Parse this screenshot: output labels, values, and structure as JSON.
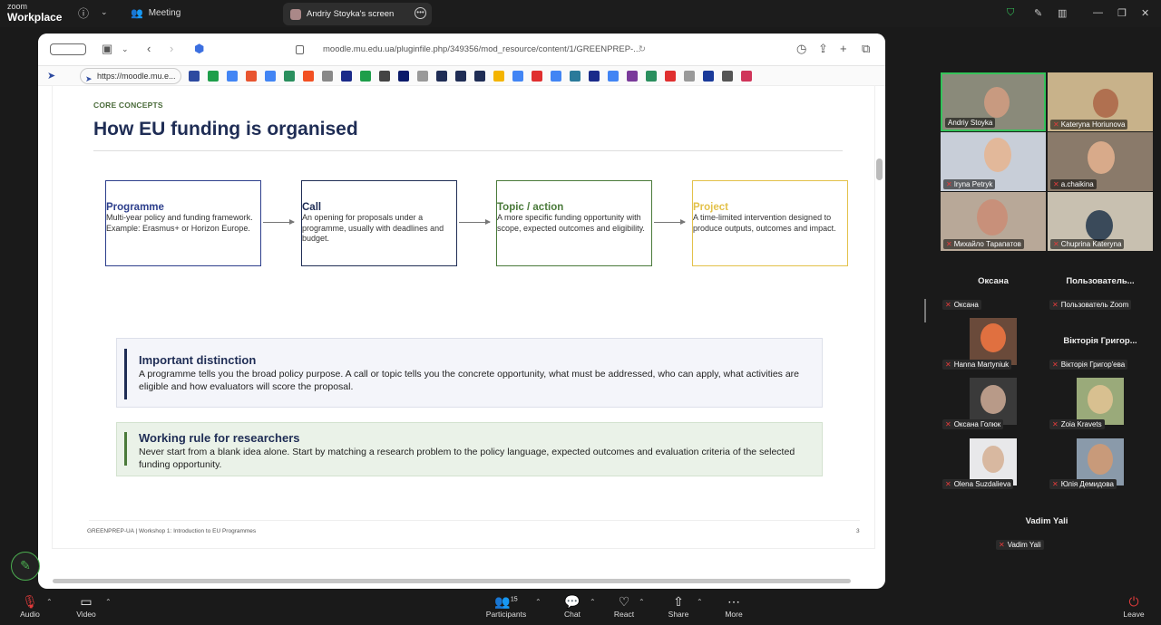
{
  "app": {
    "brand_top": "zoom",
    "brand_bottom": "Workplace",
    "meeting_label": "Meeting",
    "screen_tab": "Andriy Stoyka's screen"
  },
  "browser": {
    "url": "moodle.mu.edu.ua/pluginfile.php/349356/mod_resource/content/1/GREENPREP-...",
    "bookmark_tab": "https://moodle.mu.e..."
  },
  "slide": {
    "kicker": "CORE CONCEPTS",
    "title": "How EU funding is organised",
    "boxes": [
      {
        "title": "Programme",
        "body": "Multi-year policy and funding framework. Example: Erasmus+ or Horizon Europe.",
        "color": "#2d3f8c"
      },
      {
        "title": "Call",
        "body": "An opening for proposals under a programme, usually with deadlines and budget.",
        "color": "#1f2d55"
      },
      {
        "title": "Topic / action",
        "body": "A more specific funding opportunity with scope, expected outcomes and eligibility.",
        "color": "#4a7a3a"
      },
      {
        "title": "Project",
        "body": "A time-limited intervention designed to produce outputs, outcomes and impact.",
        "color": "#e3c14a"
      }
    ],
    "callouts": [
      {
        "title": "Important distinction",
        "body": "A programme tells you the broad policy purpose. A call or topic tells you the concrete opportunity, what must be addressed, who can apply, what activities are eligible and how evaluators will score the proposal."
      },
      {
        "title": "Working rule for researchers",
        "body": "Never start from a blank idea alone. Start by matching a research problem to the policy language, expected outcomes and evaluation criteria of the selected funding opportunity."
      }
    ],
    "footer": "GREENPREP-UA | Workshop 1: Introduction to EU Programmes",
    "page": "3"
  },
  "gallery": {
    "video_tiles": [
      {
        "name": "Andriy Stoyka"
      },
      {
        "name": "Kateryna Horiunova"
      },
      {
        "name": "Iryna Petryk"
      },
      {
        "name": "a.chaikina"
      },
      {
        "name": "Михайло Тарапатов"
      },
      {
        "name": "Chuprina Kateryna"
      }
    ],
    "audio_tiles": [
      {
        "label": "Оксана",
        "name": "Оксана"
      },
      {
        "label": "Пользователь...",
        "name": "Пользователь Zoom"
      },
      {
        "label": "",
        "name": "Hanna Martyniuk"
      },
      {
        "label": "Вікторія Григор...",
        "name": "Вікторія Григор'ева"
      },
      {
        "label": "",
        "name": "Оксана Голюк"
      },
      {
        "label": "",
        "name": "Zoia Kravets"
      },
      {
        "label": "",
        "name": "Olena Suzdalieva"
      },
      {
        "label": "",
        "name": "Юлія Демидова"
      },
      {
        "label": "Vadim Yali",
        "name": "Vadim Yali"
      }
    ]
  },
  "toolbar": {
    "audio": "Audio",
    "video": "Video",
    "participants": "Participants",
    "participants_count": "15",
    "chat": "Chat",
    "react": "React",
    "share": "Share",
    "more": "More",
    "leave": "Leave"
  },
  "colors": {
    "accent_green": "#4caf50",
    "mic_muted": "#e23b3b",
    "slide_navy": "#1f2d55"
  }
}
